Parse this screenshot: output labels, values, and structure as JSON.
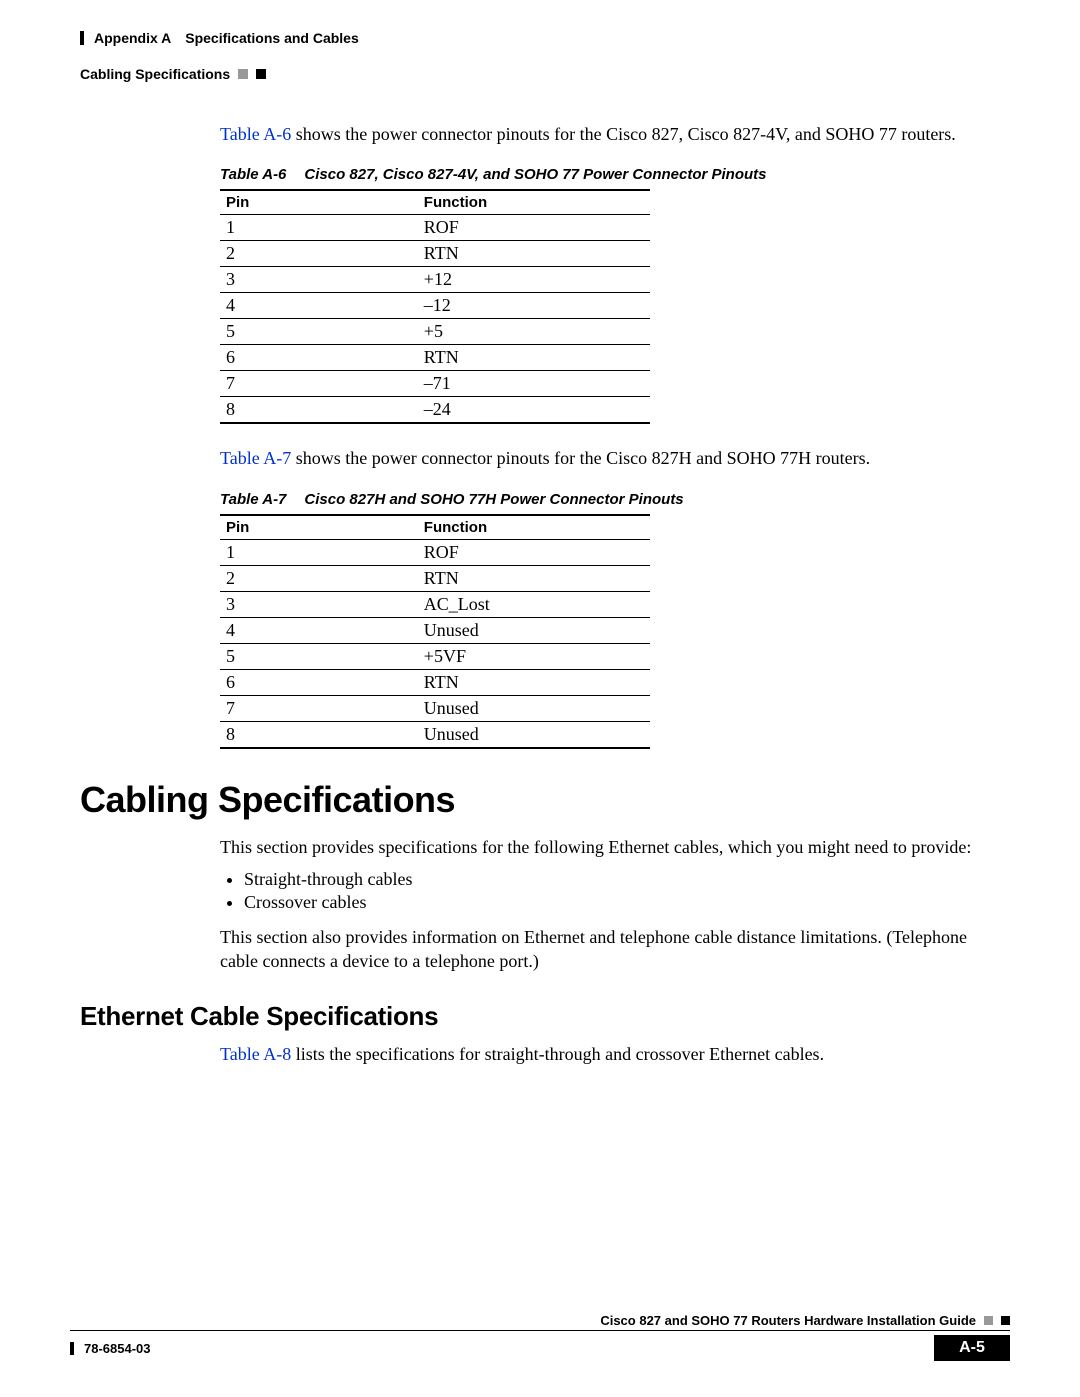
{
  "header": {
    "left": "Appendix A Specifications and Cables",
    "right": "Cabling Specifications"
  },
  "intro1": {
    "link": "Table A-6",
    "rest": " shows the power connector pinouts for the Cisco 827, Cisco 827-4V, and SOHO 77 routers."
  },
  "table6": {
    "name": "Table A-6",
    "title": "Cisco 827, Cisco 827-4V, and SOHO 77 Power Connector Pinouts",
    "headers": {
      "pin": "Pin",
      "func": "Function"
    },
    "rows": [
      {
        "pin": "1",
        "func": "ROF"
      },
      {
        "pin": "2",
        "func": "RTN"
      },
      {
        "pin": "3",
        "func": "+12"
      },
      {
        "pin": "4",
        "func": "–12"
      },
      {
        "pin": "5",
        "func": "+5"
      },
      {
        "pin": "6",
        "func": "RTN"
      },
      {
        "pin": "7",
        "func": "–71"
      },
      {
        "pin": "8",
        "func": "–24"
      }
    ]
  },
  "intro2": {
    "link": "Table A-7",
    "rest": " shows the power connector pinouts for the Cisco 827H and SOHO 77H routers."
  },
  "table7": {
    "name": "Table A-7",
    "title": "Cisco 827H and SOHO 77H Power Connector Pinouts",
    "headers": {
      "pin": "Pin",
      "func": "Function"
    },
    "rows": [
      {
        "pin": "1",
        "func": "ROF"
      },
      {
        "pin": "2",
        "func": "RTN"
      },
      {
        "pin": "3",
        "func": "AC_Lost"
      },
      {
        "pin": "4",
        "func": "Unused"
      },
      {
        "pin": "5",
        "func": "+5VF"
      },
      {
        "pin": "6",
        "func": "RTN"
      },
      {
        "pin": "7",
        "func": "Unused"
      },
      {
        "pin": "8",
        "func": "Unused"
      }
    ]
  },
  "section1": {
    "heading": "Cabling Specifications",
    "para1": "This section provides specifications for the following Ethernet cables, which you might need to provide:",
    "bullets": [
      "Straight-through cables",
      "Crossover cables"
    ],
    "para2": "This section also provides information on Ethernet and telephone cable distance limitations. (Telephone cable connects a device to a telephone port.)"
  },
  "section2": {
    "heading": "Ethernet Cable Specifications",
    "link": "Table A-8",
    "rest": " lists the specifications for straight-through and crossover Ethernet cables."
  },
  "footer": {
    "guide": "Cisco 827 and SOHO 77 Routers Hardware Installation Guide",
    "docnum": "78-6854-03",
    "pagenum": "A-5"
  }
}
